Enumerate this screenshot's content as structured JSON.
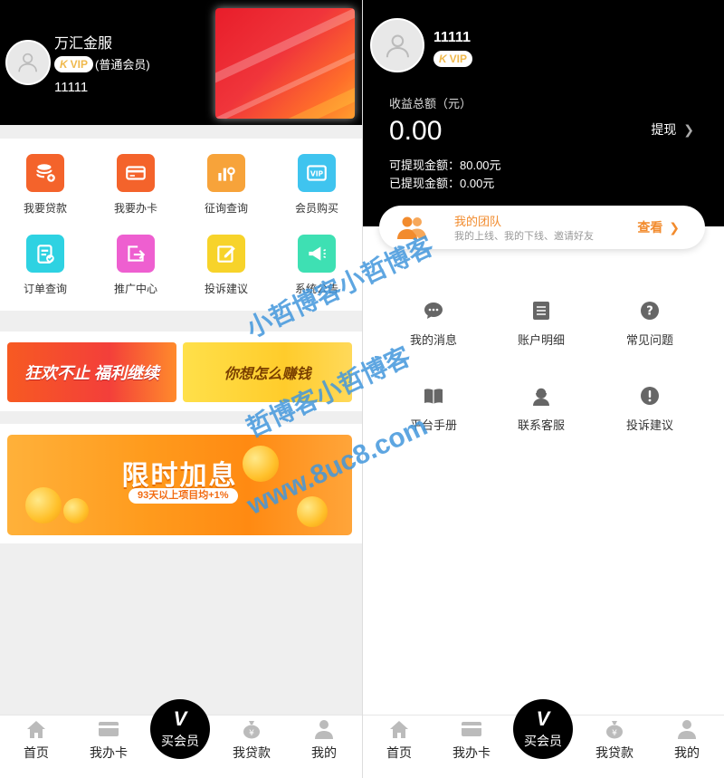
{
  "left": {
    "header": {
      "name": "万汇金服",
      "vip_label": "VIP",
      "member_type": "(普通会员)",
      "user_id": "11111"
    },
    "grid": [
      {
        "label": "我要贷款",
        "icon": "database-plus-icon",
        "color": "#f4632b"
      },
      {
        "label": "我要办卡",
        "icon": "credit-card-icon",
        "color": "#f4632b"
      },
      {
        "label": "征询查询",
        "icon": "bar-chart-search-icon",
        "color": "#f7a33a"
      },
      {
        "label": "会员购买",
        "icon": "vip-card-icon",
        "color": "#3fc4ef"
      },
      {
        "label": "订单查询",
        "icon": "clipboard-check-icon",
        "color": "#2ed2e2"
      },
      {
        "label": "推广中心",
        "icon": "share-box-icon",
        "color": "#ee5fd0"
      },
      {
        "label": "投诉建议",
        "icon": "edit-note-icon",
        "color": "#f7d32a"
      },
      {
        "label": "系统公告",
        "icon": "megaphone-icon",
        "color": "#3ee0b3"
      }
    ],
    "promos": {
      "promo1": "狂欢不止 福利继续",
      "promo2": "你想怎么赚钱",
      "big_title": "限时加息",
      "big_sub": "93天以上项目均+1%"
    },
    "tabbar": {
      "home": "首页",
      "card": "我办卡",
      "vip": "买会员",
      "loan": "我贷款",
      "mine": "我的",
      "center_glyph": "V"
    }
  },
  "right": {
    "header": {
      "user_id": "11111",
      "vip_label": "VIP",
      "total_label": "收益总额（元）",
      "total": "0.00",
      "withdraw": "提现",
      "available": "可提现金额：80.00元",
      "withdrawn": "已提现金额：0.00元"
    },
    "team": {
      "title": "我的团队",
      "subtitle": "我的上线、我的下线、邀请好友",
      "view": "查看"
    },
    "grid": [
      {
        "label": "我的消息",
        "icon": "chat-bubble-icon"
      },
      {
        "label": "账户明细",
        "icon": "document-list-icon"
      },
      {
        "label": "常见问题",
        "icon": "question-circle-icon"
      },
      {
        "label": "平台手册",
        "icon": "book-icon"
      },
      {
        "label": "联系客服",
        "icon": "customer-service-icon"
      },
      {
        "label": "投诉建议",
        "icon": "exclamation-circle-icon"
      }
    ],
    "tabbar": {
      "home": "首页",
      "card": "我办卡",
      "vip": "买会员",
      "loan": "我贷款",
      "mine": "我的",
      "center_glyph": "V"
    }
  },
  "watermark": {
    "line1": "小哲博客小哲博客",
    "line2": "哲博客小哲博客",
    "line3": "www.8uc8.com"
  }
}
